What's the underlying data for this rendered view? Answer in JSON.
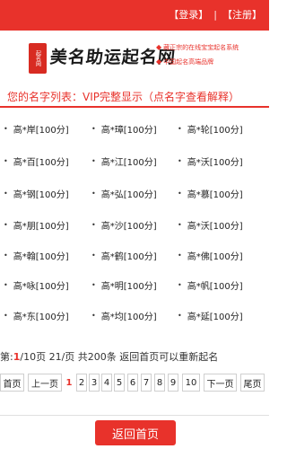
{
  "header": {
    "login_label": "【登录】",
    "separator": "|",
    "register_label": "【注册】",
    "colors": {
      "accent": "#e8322b"
    }
  },
  "brand": {
    "seal_text": "起名网",
    "name": "美名助运起名网",
    "slogans": [
      "藏正宗的在线宝宝起名系统",
      "中国起名高端品牌"
    ]
  },
  "list": {
    "title": "您的名字列表：VIP完整显示（点名字查看解释）",
    "rows": [
      [
        "高*岸[100分]",
        "高*璋[100分]",
        "高*轮[100分]"
      ],
      [
        "高*百[100分]",
        "高*江[100分]",
        "高*沃[100分]"
      ],
      [
        "高*钢[100分]",
        "高*弘[100分]",
        "高*慕[100分]"
      ],
      [
        "高*朋[100分]",
        "高*沙[100分]",
        "高*沃[100分]"
      ],
      [
        "高*翰[100分]",
        "高*鹤[100分]",
        "高*佛[100分]"
      ],
      [
        "高*咏[100分]",
        "高*明[100分]",
        "高*帆[100分]"
      ],
      [
        "高*东[100分]",
        "高*均[100分]",
        "高*延[100分]"
      ]
    ]
  },
  "summary": {
    "prefix": "第:",
    "current": "1",
    "rest": "/10页   21/页  共200条   返回首页可以重新起名"
  },
  "pagination": {
    "first": "首页",
    "prev": "上一页",
    "pages": [
      "1",
      "2",
      "3",
      "4",
      "5",
      "6",
      "7",
      "8",
      "9",
      "10"
    ],
    "next": "下一页",
    "last": "尾页"
  },
  "back_button": "返回首页"
}
